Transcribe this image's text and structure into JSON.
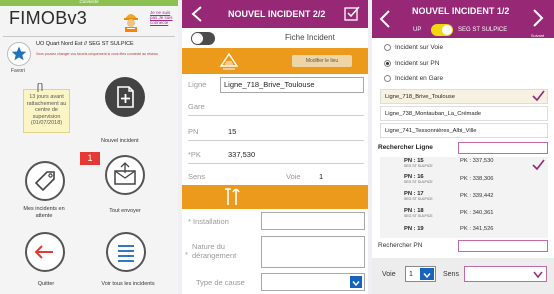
{
  "screen1": {
    "status": "Connecté",
    "app_title": "FIMOBv3",
    "not_you_link": "Je ne suis pas Je suis connecté",
    "site_label": "UO Quart Nord Est // SEG ST SULPICE",
    "warning_text": "Vous pouvez changer vos favoris uniquement si vous êtes connecté au réseau",
    "favorites_label": "Favori",
    "note_text": "13 jours avant rattachement au centre de supervision (01/07/2018)",
    "new_incident_label": "Nouvel incident",
    "pending_label": "Mes incidents en attente",
    "pending_count": "1",
    "send_all_label": "Tout envoyer",
    "quit_label": "Quitter",
    "view_all_label": "Voir tous les incidents"
  },
  "screen2": {
    "title": "NOUVEL INCIDENT 2/2",
    "fiche_label": "Fiche Incident",
    "modify_place_button": "Modifier le lieu",
    "fields": {
      "ligne_label": "Ligne",
      "ligne_value": "Ligne_718_Brive_Toulouse",
      "gare_label": "Gare",
      "pn_label": "PN",
      "pn_value": "15",
      "pk_label": "*PK",
      "pk_value": "337,530",
      "sens_label": "Sens",
      "voie_label": "Voie",
      "voie_value": "1"
    },
    "installation_label": "* Installation",
    "nature_label": "Nature du dérangement",
    "nature_asterisk": "*",
    "cause_label": "Type de cause"
  },
  "screen3": {
    "title": "NOUVEL INCIDENT 1/2",
    "toggle_left": "UP",
    "toggle_right": "SEG ST SULPICE",
    "next_label": "Suivant",
    "options": [
      "Incident sur Voie",
      "Incident sur PN",
      "Incident en Gare"
    ],
    "selected_option": 1,
    "lines": [
      "Ligne_718_Brive_Toulouse",
      "Ligne_738_Montauban_La_Crémade",
      "Ligne_741_Tessonnières_Albi_Ville"
    ],
    "selected_line": 0,
    "search_line_label": "Rechercher Ligne",
    "pn_rows": [
      {
        "pn": "PN : 15",
        "seg": "SEG ST SULPICE",
        "pk": "PK : 337,530",
        "checked": true
      },
      {
        "pn": "PN : 16",
        "seg": "SEG ST SULPICE",
        "pk": "PK : 338,306",
        "checked": false
      },
      {
        "pn": "PN : 17",
        "seg": "SEG ST SULPICE",
        "pk": "PK : 339,442",
        "checked": false
      },
      {
        "pn": "PN : 18",
        "seg": "SEG ST SULPICE",
        "pk": "PK : 340,361",
        "checked": false
      },
      {
        "pn": "PN : 19",
        "seg": "",
        "pk": "PK : 341,526",
        "checked": false
      }
    ],
    "search_pn_label": "Rechercher PN",
    "voie_label": "Voie",
    "voie_value": "1",
    "sens_label": "Sens"
  },
  "colors": {
    "accent": "#962876",
    "orange": "#ec9a1b",
    "green": "#8cc152",
    "dark": "#434343",
    "blue": "#1565c0"
  }
}
